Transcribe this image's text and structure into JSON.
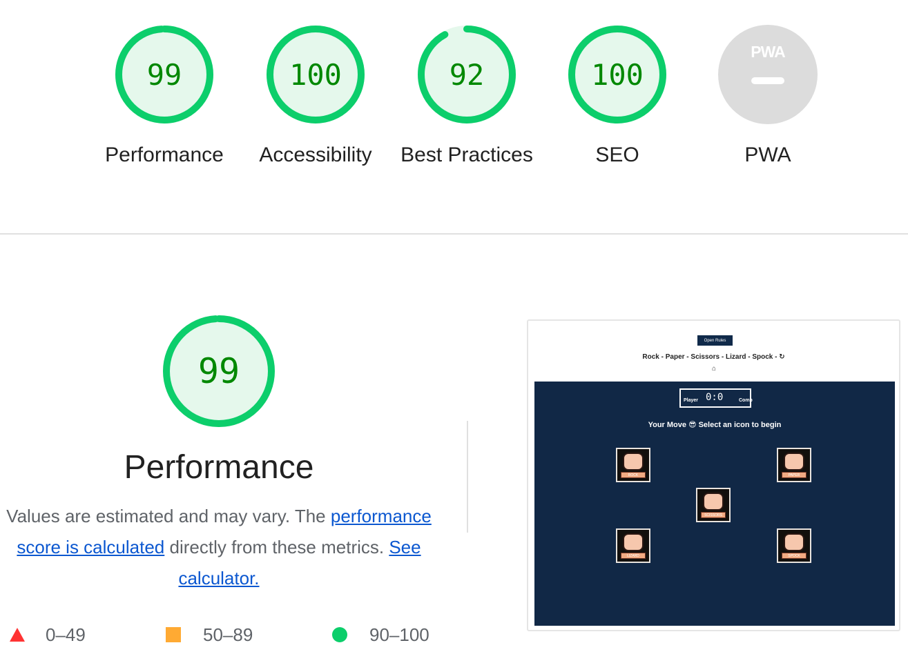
{
  "categories": [
    {
      "score": "99",
      "label": "Performance",
      "value": 0.99
    },
    {
      "score": "100",
      "label": "Accessibility",
      "value": 1.0
    },
    {
      "score": "92",
      "label": "Best Practices",
      "value": 0.92
    },
    {
      "score": "100",
      "label": "SEO",
      "value": 1.0
    },
    {
      "label": "PWA",
      "pwa_badge": "PWA"
    }
  ],
  "performance": {
    "score": "99",
    "value": 0.99,
    "title": "Performance",
    "desc_prefix": "Values are estimated and may vary. The ",
    "desc_link": "performance score is calculated",
    "desc_mid": " directly from these metrics. ",
    "calc_link": "See calculator."
  },
  "legend": {
    "fail": "0–49",
    "average": "50–89",
    "pass": "90–100"
  },
  "screenshot": {
    "rules_button": "Open Rules",
    "title": "Rock - Paper - Scissors - Lizard - Spock - ↻",
    "github_icon": "⌂",
    "player_label": "Player",
    "score": "0:0",
    "comp_label": "Comp",
    "prompt": "Your Move 😎 Select an icon to begin",
    "icons": [
      "ROCK",
      "PAPER",
      "SCISSORS",
      "LIZARD",
      "SPOCK"
    ]
  },
  "colors": {
    "pass": "#0cce6b",
    "pass_bg": "#e5f8ec",
    "pass_text": "#008800",
    "pwa_gray": "#dcdcdc",
    "link": "#0b57d0"
  }
}
